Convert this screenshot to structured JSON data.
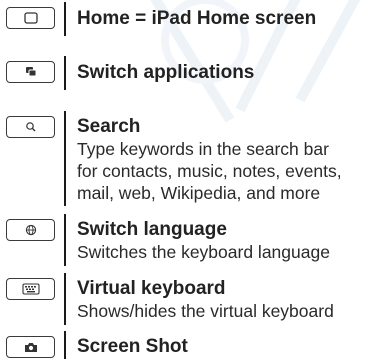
{
  "items": [
    {
      "icon": "home-square-icon",
      "title": "Home = iPad Home screen",
      "description": []
    },
    {
      "icon": "switch-apps-icon",
      "title": "Switch applications",
      "description": []
    },
    {
      "icon": "search-icon",
      "title": "Search",
      "description": [
        "Type keywords in the search bar",
        "for contacts, music, notes, events,",
        "mail, web, Wikipedia, and more"
      ]
    },
    {
      "icon": "globe-icon",
      "title": "Switch language",
      "description": [
        "Switches the keyboard language"
      ]
    },
    {
      "icon": "keyboard-icon",
      "title": "Virtual keyboard",
      "description": [
        "Shows/hides the virtual keyboard"
      ]
    },
    {
      "icon": "camera-icon",
      "title": "Screen Shot",
      "description": []
    }
  ]
}
